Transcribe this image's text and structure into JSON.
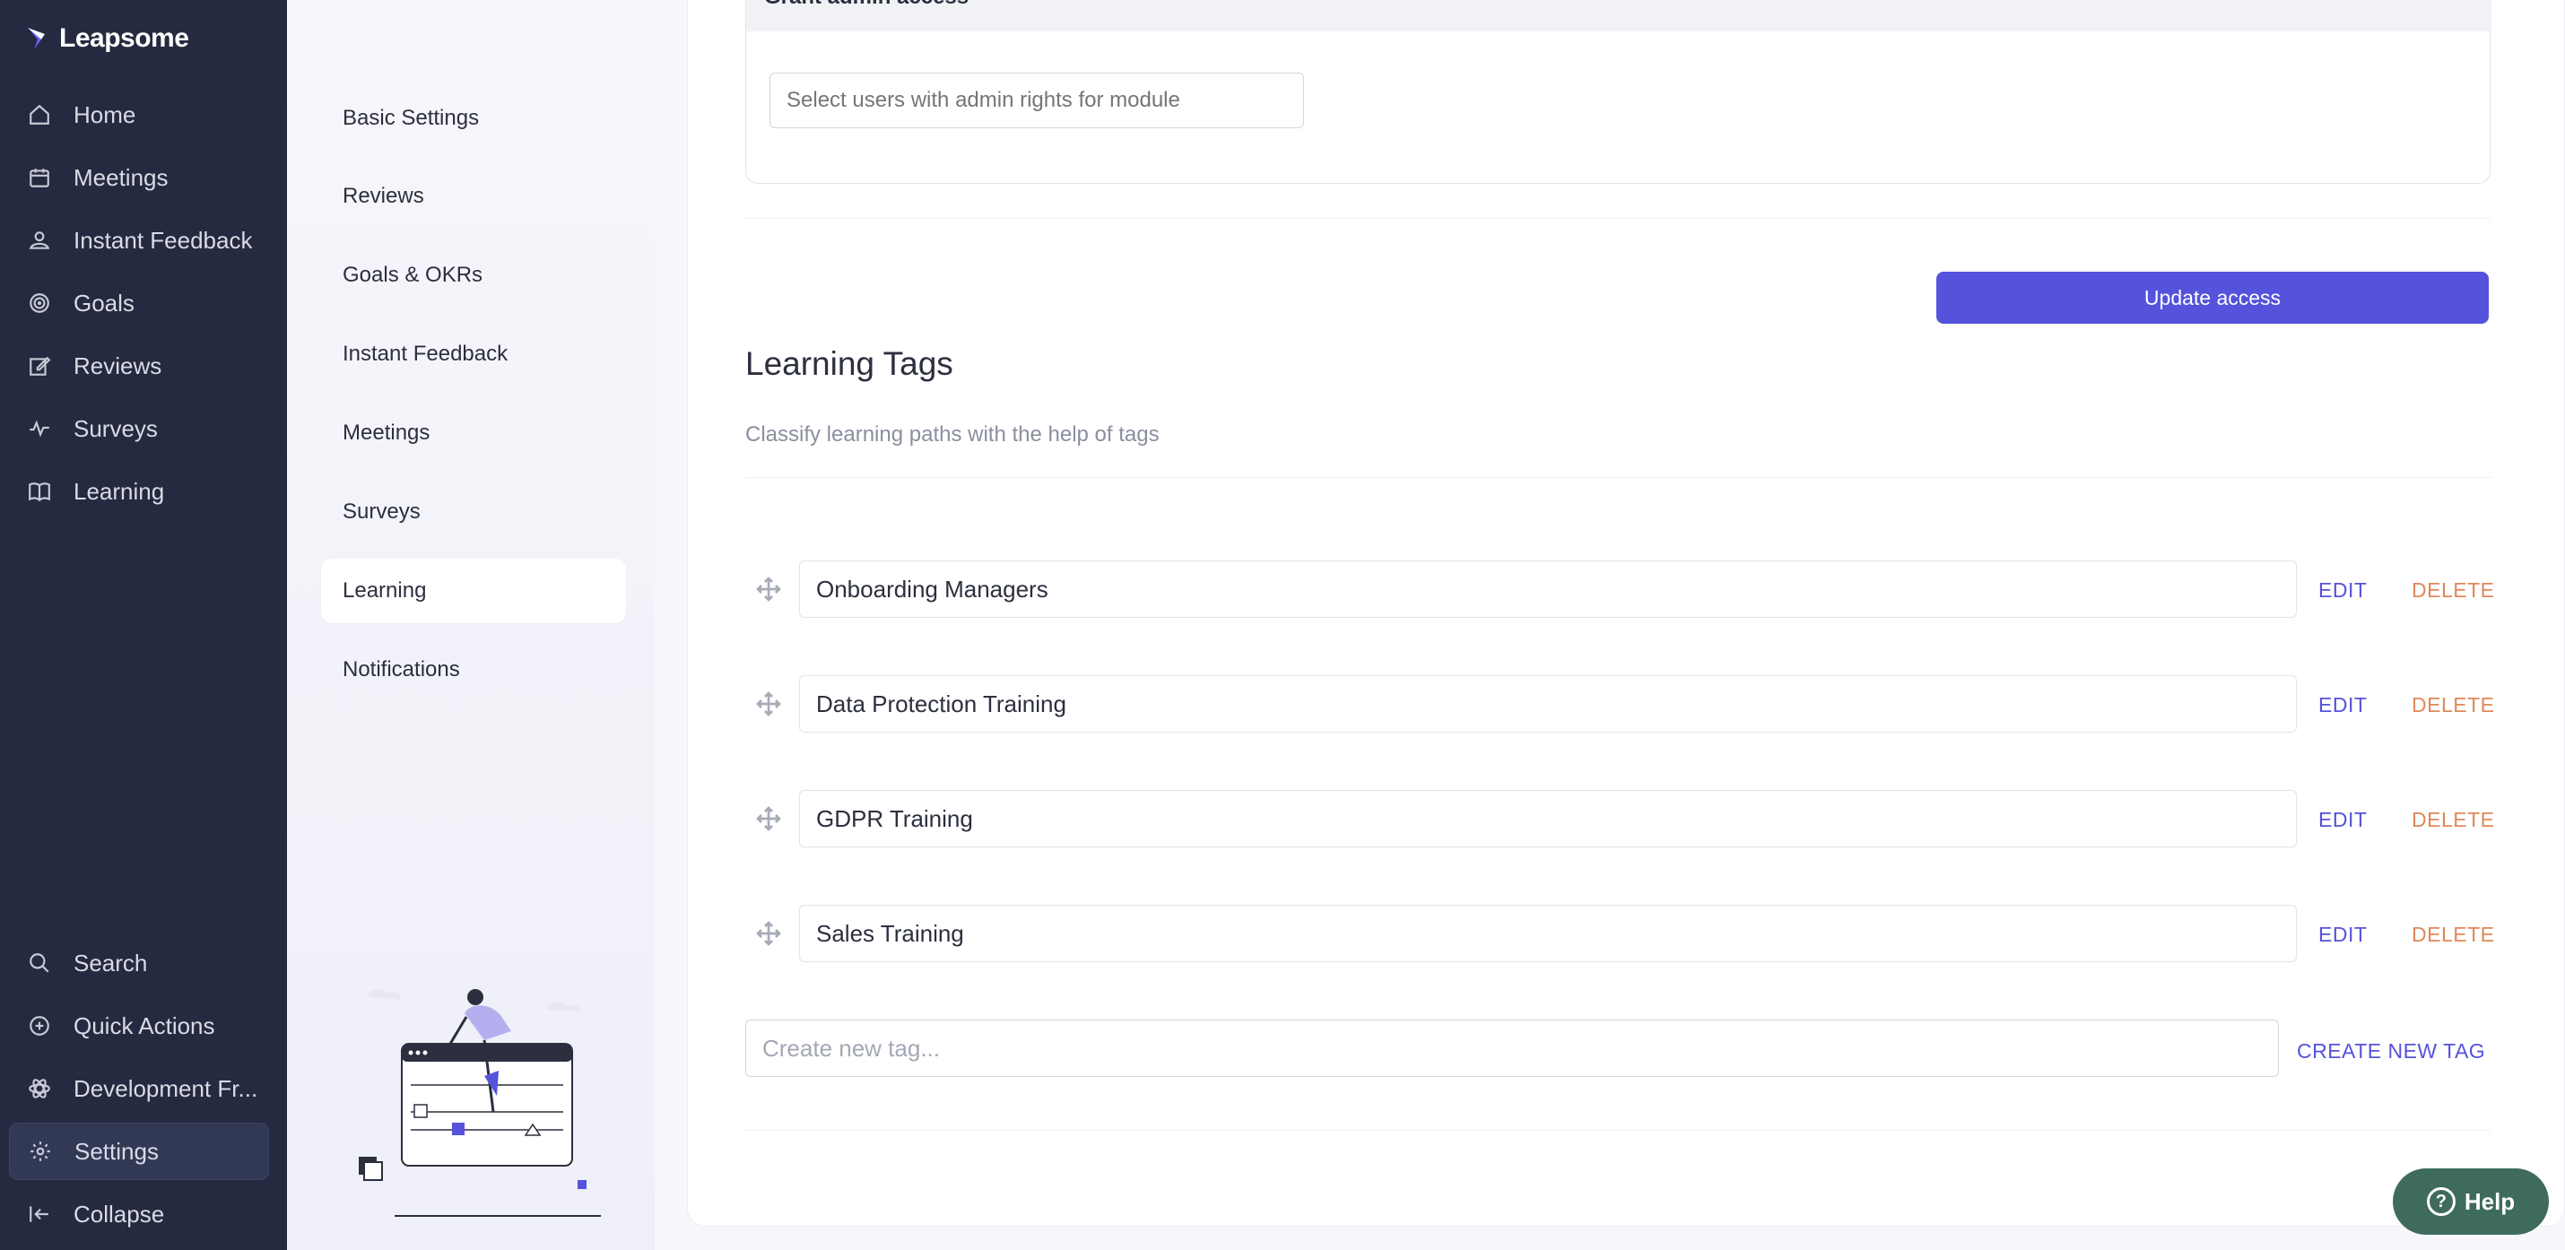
{
  "brand": {
    "name": "Leapsome",
    "accent": "#5552dc"
  },
  "nav": {
    "top_items": [
      {
        "label": "Home",
        "icon": "home-icon"
      },
      {
        "label": "Meetings",
        "icon": "calendar-icon"
      },
      {
        "label": "Instant Feedback",
        "icon": "feedback-icon"
      },
      {
        "label": "Goals",
        "icon": "target-icon"
      },
      {
        "label": "Reviews",
        "icon": "edit-icon"
      },
      {
        "label": "Surveys",
        "icon": "pulse-icon"
      },
      {
        "label": "Learning",
        "icon": "book-icon"
      }
    ],
    "bottom_items": [
      {
        "label": "Search",
        "icon": "search-icon"
      },
      {
        "label": "Quick Actions",
        "icon": "plus-circle-icon"
      },
      {
        "label": "Development Fr...",
        "icon": "atom-icon"
      },
      {
        "label": "Settings",
        "icon": "gear-icon",
        "active": true
      },
      {
        "label": "Collapse",
        "icon": "collapse-icon"
      }
    ]
  },
  "settings_menu": {
    "items": [
      {
        "label": "Basic Settings"
      },
      {
        "label": "Reviews"
      },
      {
        "label": "Goals & OKRs"
      },
      {
        "label": "Instant Feedback"
      },
      {
        "label": "Meetings"
      },
      {
        "label": "Surveys"
      },
      {
        "label": "Learning",
        "active": true
      },
      {
        "label": "Notifications"
      }
    ]
  },
  "admin_access": {
    "header": "Grant admin access",
    "placeholder": "Select users with admin rights for module",
    "update_label": "Update access"
  },
  "learning_tags": {
    "title": "Learning Tags",
    "description": "Classify learning paths with the help of tags",
    "tags": [
      {
        "name": "Onboarding Managers"
      },
      {
        "name": "Data Protection Training"
      },
      {
        "name": "GDPR Training"
      },
      {
        "name": "Sales Training"
      }
    ],
    "edit_label": "EDIT",
    "delete_label": "DELETE",
    "new_tag_placeholder": "Create new tag...",
    "create_label": "CREATE NEW TAG"
  },
  "help": {
    "label": "Help"
  }
}
